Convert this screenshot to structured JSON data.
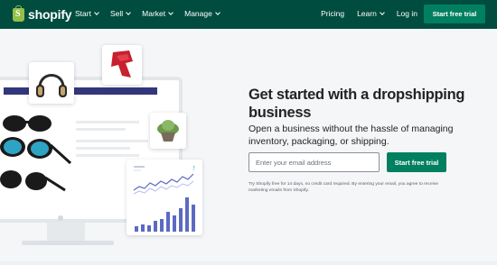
{
  "brand": {
    "name": "shopify",
    "logo_icon": "shopify-bag-icon",
    "logo_color": "#95bf47"
  },
  "nav": {
    "background": "#004c3f",
    "left_items": [
      {
        "label": "Start",
        "icon": "chevron-down-icon"
      },
      {
        "label": "Sell",
        "icon": "chevron-down-icon"
      },
      {
        "label": "Market",
        "icon": "chevron-down-icon"
      },
      {
        "label": "Manage",
        "icon": "chevron-down-icon"
      }
    ],
    "right_items": [
      {
        "label": "Pricing"
      },
      {
        "label": "Learn",
        "icon": "chevron-down-icon"
      },
      {
        "label": "Log in"
      }
    ],
    "cta_label": "Start free trial",
    "cta_color": "#008060"
  },
  "hero": {
    "title": "Get started with a dropshipping business",
    "subtitle": "Open a business without the hassle of managing inventory, packaging, or shipping.",
    "email_placeholder": "Enter your email address",
    "email_value": "",
    "cta_label": "Start free trial",
    "disclaimer": "Try Shopify free for 14 days, no credit card required. By entering your email, you agree to receive marketing emails from Shopify."
  },
  "illustration": {
    "product_images": [
      "headphones-image",
      "red-scarf-image",
      "succulent-plant-image",
      "sunglasses-image"
    ],
    "chart_icon": "trend-up-arrow-icon",
    "accent_color": "#33367a",
    "bar_color": "#5c6ac4"
  }
}
